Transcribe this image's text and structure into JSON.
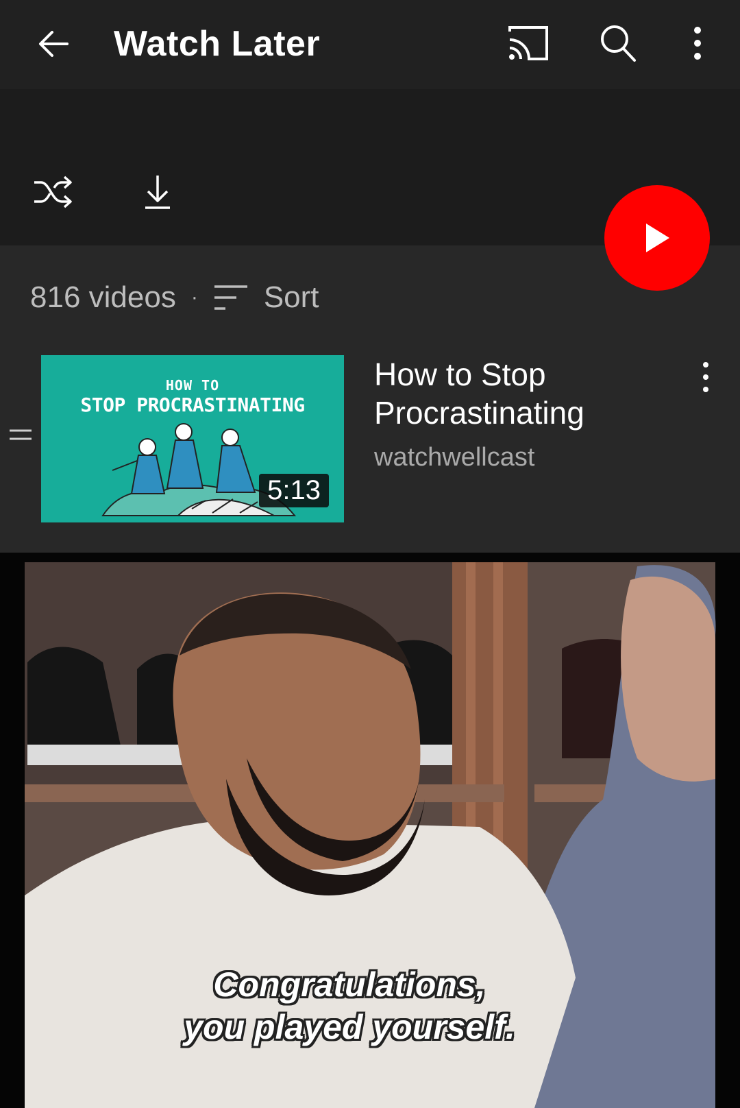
{
  "topbar": {
    "title": "Watch Later",
    "icons": [
      "back-arrow-icon",
      "cast-icon",
      "search-icon",
      "more-vertical-icon"
    ]
  },
  "header_panel": {
    "icons": [
      "shuffle-icon",
      "download-icon"
    ]
  },
  "playlist": {
    "video_count": "816 videos",
    "separator": "·",
    "sort_label": "Sort"
  },
  "play_button": {
    "icon": "play-icon",
    "color": "#ff0000"
  },
  "videos": [
    {
      "title": "How to Stop Procrastinating",
      "channel": "watchwellcast",
      "duration": "5:13",
      "thumbnail_line1": "HOW TO",
      "thumbnail_line2": "STOP PROCRASTINATING",
      "thumbnail_color": "#17ad9a"
    }
  ],
  "meme": {
    "caption_line1": "Congratulations,",
    "caption_line2": "you played yourself."
  }
}
